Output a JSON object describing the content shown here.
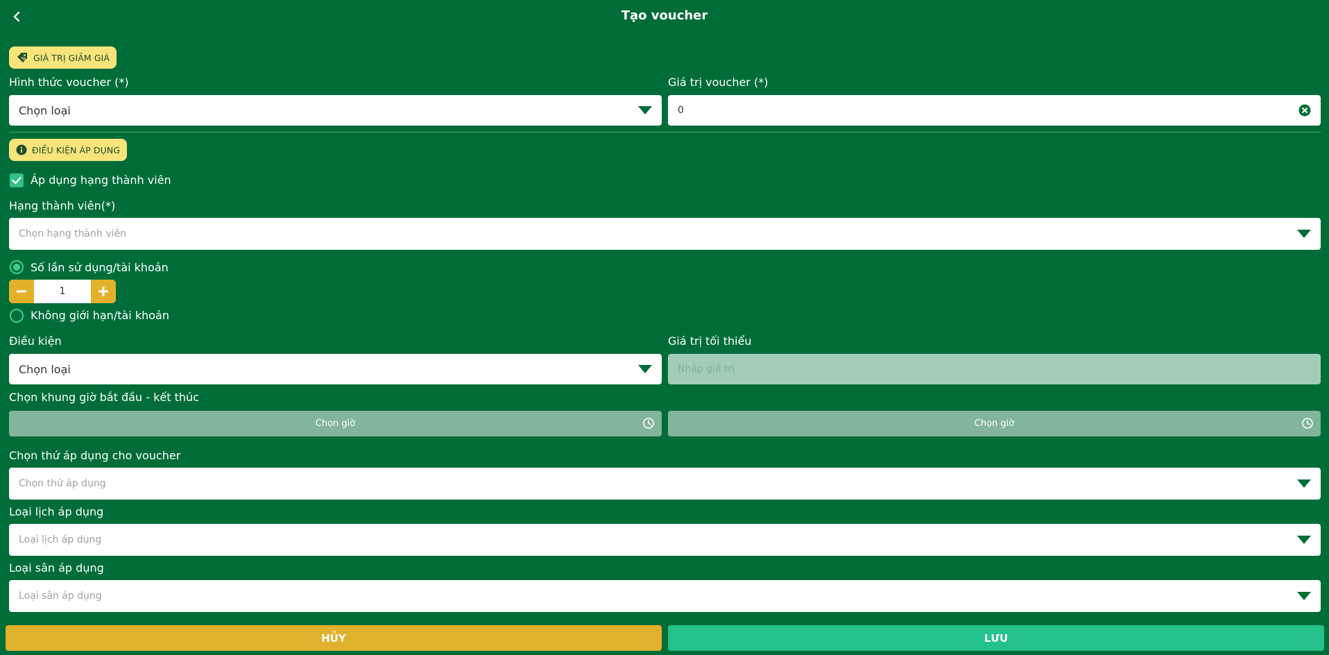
{
  "header": {
    "title": "Tạo voucher"
  },
  "discount_section": {
    "badge": "GIÁ TRỊ GIẢM GIÁ",
    "voucher_type_label": "Hình thức voucher (*)",
    "voucher_type_value": "Chọn loại",
    "voucher_value_label": "Giá trị voucher (*)",
    "voucher_value": "0"
  },
  "condition_section": {
    "badge": "ĐIỀU KIỆN ÁP DỤNG",
    "apply_member_tier_label": "Áp dụng hạng thành viên",
    "apply_member_tier_checked": true,
    "member_tier_label": "Hạng thành viên(*)",
    "member_tier_placeholder": "Chọn hạng thành viên",
    "usage_per_account_label": "Số lần sử dụng/tài khoản",
    "usage_count": "1",
    "unlimited_label": "Không giới hạn/tài khoản",
    "selected_usage_option": "usage_per_account",
    "condition_label": "Điều kiện",
    "condition_value": "Chọn loại",
    "min_value_label": "Giá trị tối thiểu",
    "min_value_placeholder": "Nhập giá trị",
    "time_range_label": "Chọn khung giờ bắt đầu - kết thúc",
    "start_time_button": "Chọn giờ",
    "end_time_button": "Chọn giờ",
    "weekday_label": "Chọn thứ áp dụng cho voucher",
    "weekday_placeholder": "Chọn thứ áp dụng",
    "schedule_type_label": "Loại lịch áp dụng",
    "schedule_type_placeholder": "Loại lịch áp dụng",
    "court_type_label": "Loại sân áp dụng",
    "court_type_placeholder": "Loại sân áp dụng"
  },
  "footer": {
    "cancel_label": "HỦY",
    "save_label": "LƯU"
  },
  "colors": {
    "background": "#006d39",
    "badge": "#f7e47a",
    "cancel": "#e0b12c",
    "save": "#24c18a",
    "dropdown_arrow": "#006d39"
  }
}
